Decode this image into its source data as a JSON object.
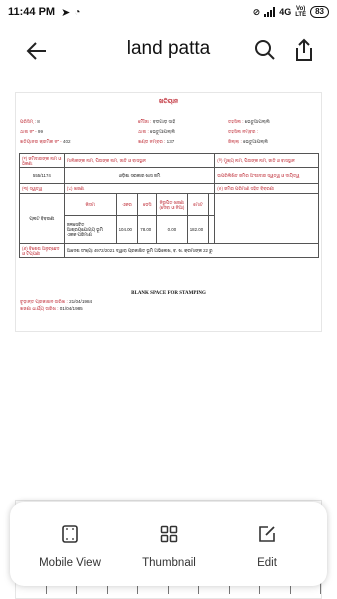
{
  "status_bar": {
    "time": "11:44 PM",
    "network": "4G",
    "volte_top": "Vo)",
    "volte_bottom": "LTE",
    "battery": "83"
  },
  "header": {
    "title": "land patta"
  },
  "document": {
    "title": "ଖତିୟାନ",
    "meta": [
      {
        "label": "ପରିସିମ୍ : ",
        "value": "8"
      },
      {
        "label": "ମୌଜା : ",
        "value": "ବଡଗାଡ଼ ସାହି"
      },
      {
        "label": "ତହସିଲ : ",
        "value": "ଭେତୁଆପଲ୍ଲି"
      },
      {
        "label": "ଥାନା ନଂ - ",
        "value": "99"
      },
      {
        "label": "ଥାନା : ",
        "value": "ଭେତୁଆପଲ୍ଲି"
      },
      {
        "label": "ତହସିଲ ନମ୍ବର : ",
        "value": ""
      },
      {
        "label": "ଖତିୟାନର କ୍ରମିକ ନଂ - ",
        "value": "402"
      },
      {
        "label": "ଖଣ୍ଡ ନମ୍ବର : ",
        "value": "137"
      },
      {
        "label": "ଜିଲ୍ଲା : ",
        "value": "ଭେତୁଆପଲ୍ଲି"
      }
    ],
    "table": {
      "row1": [
        "(୧) ଜମିଦାରଙ୍କ ନାମ ଓ ଠିକଣା",
        "ମାଲିକଙ୍କ ନାମ, ପିତାଙ୍କ ନାମ, ଜାତି ଓ ବାସସ୍ଥାନ",
        "(୨) ମୁଖ୍ୟ ନାମ, ପିତାଙ୍କ ନାମ, ଜାତି ଓ ବାସସ୍ଥାନ"
      ],
      "row2": [
        "555/1174",
        "ଓଡ଼ିଶା ସରକାର ଖାସ ଜମି",
        "ଉପରିଲିଖିତ ଜମିର ଅଂଶୀଦାର ସ୍ୱତ୍ୱ ଓ ଦାୟିତ୍ୱ"
      ],
      "row3": [
        "(୩) ସ୍ୱତ୍ୱ",
        "(୪) ଖଜଣା",
        "(୫) ଜମିର ପରିମାଣ ସହିତ ବିବରଣୀ"
      ],
      "sub_headers": [
        "କିସମ",
        "ଏକର",
        "ଡେସି",
        "ନିରୁପିତ ଖଜଣା (ଦେବା ଓ ନିଆ)",
        "ମୋଟ"
      ],
      "plot_label": "ପ୍ଲଟ ବିବରଣୀ",
      "plot_desc": "ଜଳସେଚିତ ଆଶ୍ରୟଯୋଗ୍ୟ ଭୂମି ଏକକ ପରିମାଣ",
      "values": [
        "104.00",
        "78.00",
        "0.00",
        "182.00"
      ],
      "row_last_label": "(୬) ବିଶେଷ ଅନୁଚ୍ଛେଦ ଓ ଟିପ୍ପଣୀ",
      "row_last_text": "ଆଦେଶ ସଂଖ୍ୟା 4972/2021 ଦ୍ୱାରା ପ୍ରକାଶିତ ଭୂମି ଅଭିଲେଖ, ବ. ଖ. କ୍ରମାଙ୍କ 22 ରୁ"
    },
    "stamp_text": "BLANK SPACE FOR STAMPING",
    "date1_label": "ଚୂଡ଼ାନ୍ତ ପ୍ରକାଶନ ତାରିଖ : ",
    "date1_value": "21/04/1984",
    "date2_label": "ଖଜଣା ଧାର୍ଯ୍ୟ ତାରିଖ : ",
    "date2_value": "01/04/1985"
  },
  "bottom_sheet": {
    "mobile_view": "Mobile View",
    "thumbnail": "Thumbnail",
    "edit": "Edit"
  },
  "colors": {
    "doc_red": "#c0303a",
    "text_dark": "#111111"
  }
}
